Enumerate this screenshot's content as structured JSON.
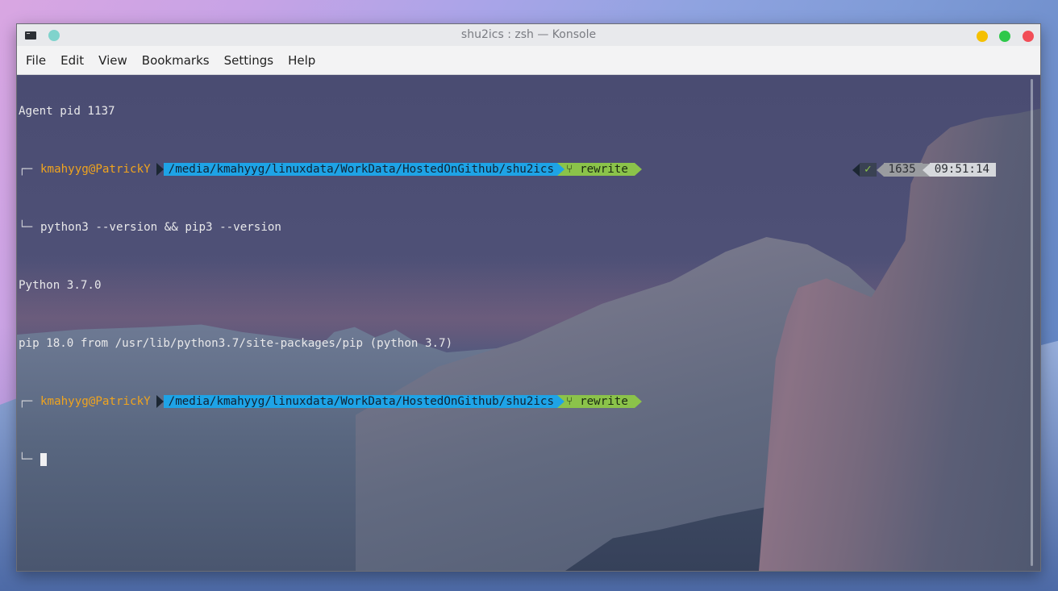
{
  "window": {
    "title": "shu2ics : zsh — Konsole"
  },
  "menu": {
    "items": [
      "File",
      "Edit",
      "View",
      "Bookmarks",
      "Settings",
      "Help"
    ]
  },
  "terminal": {
    "lines": {
      "agent": "Agent pid 1137",
      "prompt1_user": "kmahyyg@PatrickY",
      "prompt1_path": "/media/kmahyyg/linuxdata/WorkData/HostedOnGithub/shu2ics",
      "prompt1_git": "rewrite",
      "prompt1_corner": "└─",
      "command1": "python3 --version && pip3 --version",
      "out1": "Python 3.7.0",
      "out2": "pip 18.0 from /usr/lib/python3.7/site-packages/pip (python 3.7)",
      "prompt2_user": "kmahyyg@PatrickY",
      "prompt2_path": "/media/kmahyyg/linuxdata/WorkData/HostedOnGithub/shu2ics",
      "prompt2_git": "rewrite",
      "prompt2_corner": "└─"
    },
    "right_prompt": {
      "status": "✓",
      "pid": "1635",
      "time": "09:51:14"
    },
    "git_glyph": "⑂",
    "top_corner": "┌─"
  },
  "colors": {
    "user": "#f0a41e",
    "path_segment": "#1ea3e6",
    "git_segment": "#8bc34a",
    "close": "#f24d57",
    "maximize": "#2ec84a",
    "minimize": "#f5c000",
    "pin": "#7fd3cc"
  }
}
